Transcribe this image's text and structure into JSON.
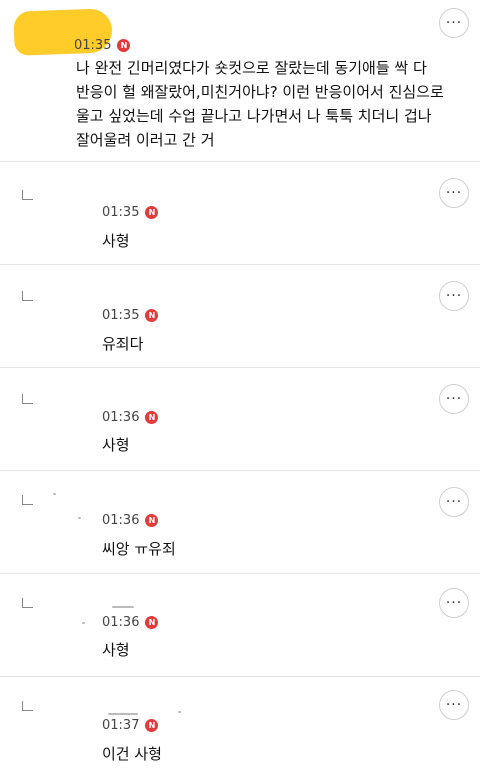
{
  "post": {
    "time": "01:35",
    "badge": "N",
    "text": "나 완전 긴머리였다가 숏컷으로 잘랐는데 동기애들 싹 다\n반응이 헐 왜잘랐어,미친거아냐? 이런 반응이어서 진심으로\n울고 싶었는데 수업 끝나고 나가면서 나 툭툭 치더니 겁나\n잘어울려 이러고 간 거",
    "more_label": "···"
  },
  "replies": [
    {
      "time": "01:35",
      "badge": "N",
      "text": "사형",
      "more_label": "···"
    },
    {
      "time": "01:35",
      "badge": "N",
      "text": "유죄다",
      "more_label": "···"
    },
    {
      "time": "01:36",
      "badge": "N",
      "text": "사형",
      "more_label": "···"
    },
    {
      "time": "01:36",
      "badge": "N",
      "text": "씨앙 ㅠ유죄",
      "more_label": "···"
    },
    {
      "time": "01:36",
      "badge": "N",
      "text": "사형",
      "more_label": "···"
    },
    {
      "time": "01:37",
      "badge": "N",
      "text": "이건 사형",
      "more_label": "···"
    }
  ],
  "colors": {
    "author_highlight": "#ffcc2a",
    "badge": "#e23b3b",
    "divider": "#e4e4e4"
  },
  "icons": {
    "more": "more-horizontal-icon",
    "reply": "reply-corner-icon",
    "new": "new-badge-icon"
  }
}
